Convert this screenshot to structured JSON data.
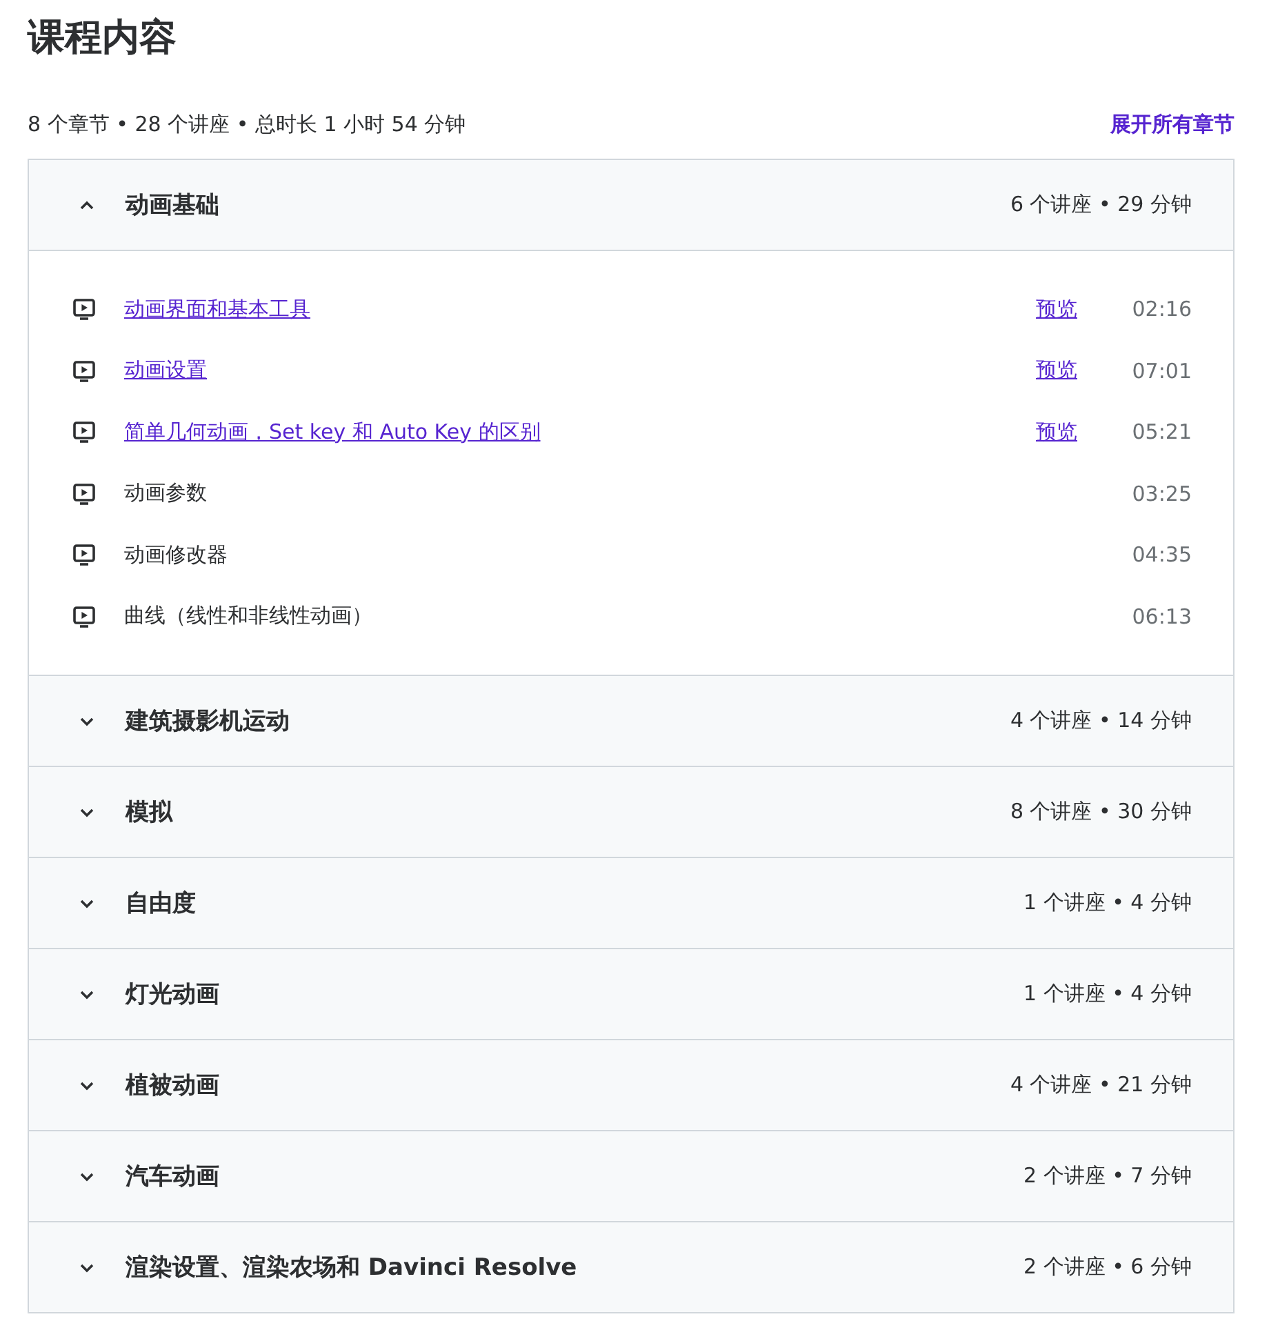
{
  "title": "课程内容",
  "summary": "8 个章节 • 28 个讲座 • 总时长 1 小时 54 分钟",
  "expand_all": "展开所有章节",
  "sections": [
    {
      "title": "动画基础",
      "meta": "6 个讲座 • 29 分钟",
      "expanded": true,
      "lectures": [
        {
          "kind": "preview",
          "title": "动画界面和基本工具",
          "preview": "预览",
          "duration": "02:16"
        },
        {
          "kind": "preview",
          "title": "动画设置",
          "preview": "预览",
          "duration": "07:01"
        },
        {
          "kind": "preview",
          "title": "简单几何动画，Set key 和 Auto Key 的区别",
          "preview": "预览",
          "duration": "05:21"
        },
        {
          "kind": "locked",
          "title": "动画参数",
          "duration": "03:25"
        },
        {
          "kind": "locked",
          "title": "动画修改器",
          "duration": "04:35"
        },
        {
          "kind": "locked",
          "title": "曲线（线性和非线性动画）",
          "duration": "06:13"
        }
      ]
    },
    {
      "title": "建筑摄影机运动",
      "meta": "4 个讲座 • 14 分钟",
      "expanded": false
    },
    {
      "title": "模拟",
      "meta": "8 个讲座 • 30 分钟",
      "expanded": false
    },
    {
      "title": "自由度",
      "meta": "1 个讲座 • 4 分钟",
      "expanded": false
    },
    {
      "title": "灯光动画",
      "meta": "1 个讲座 • 4 分钟",
      "expanded": false
    },
    {
      "title": "植被动画",
      "meta": "4 个讲座 • 21 分钟",
      "expanded": false
    },
    {
      "title": "汽车动画",
      "meta": "2 个讲座 • 7 分钟",
      "expanded": false
    },
    {
      "title": "渲染设置、渲染农场和 Davinci Resolve",
      "meta": "2 个讲座 • 6 分钟",
      "expanded": false
    }
  ]
}
